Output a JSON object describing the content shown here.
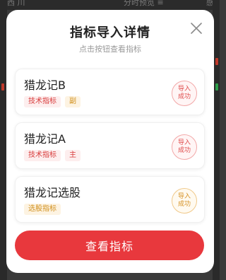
{
  "background": {
    "top_left": "西 川",
    "top_center": "分时预览 ≡",
    "top_right": "感"
  },
  "modal": {
    "title": "指标导入详情",
    "subtitle": "点击按钮查看指标",
    "close_icon": "close-icon",
    "items": [
      {
        "name": "猎龙记B",
        "tags": [
          "技术指标",
          "副"
        ],
        "status": "导入成功",
        "status_color": "#df4b4b"
      },
      {
        "name": "猎龙记A",
        "tags": [
          "技术指标",
          "主"
        ],
        "status": "导入成功",
        "status_color": "#df4b4b"
      },
      {
        "name": "猎龙记选股",
        "tags": [
          "选股指标"
        ],
        "status": "导入成功",
        "status_color": "#d69225"
      }
    ],
    "primary_button": "查看指标"
  },
  "colors": {
    "accent": "#e8383d",
    "tag_red": "#d83b3b",
    "tag_orange": "#d1901d"
  }
}
